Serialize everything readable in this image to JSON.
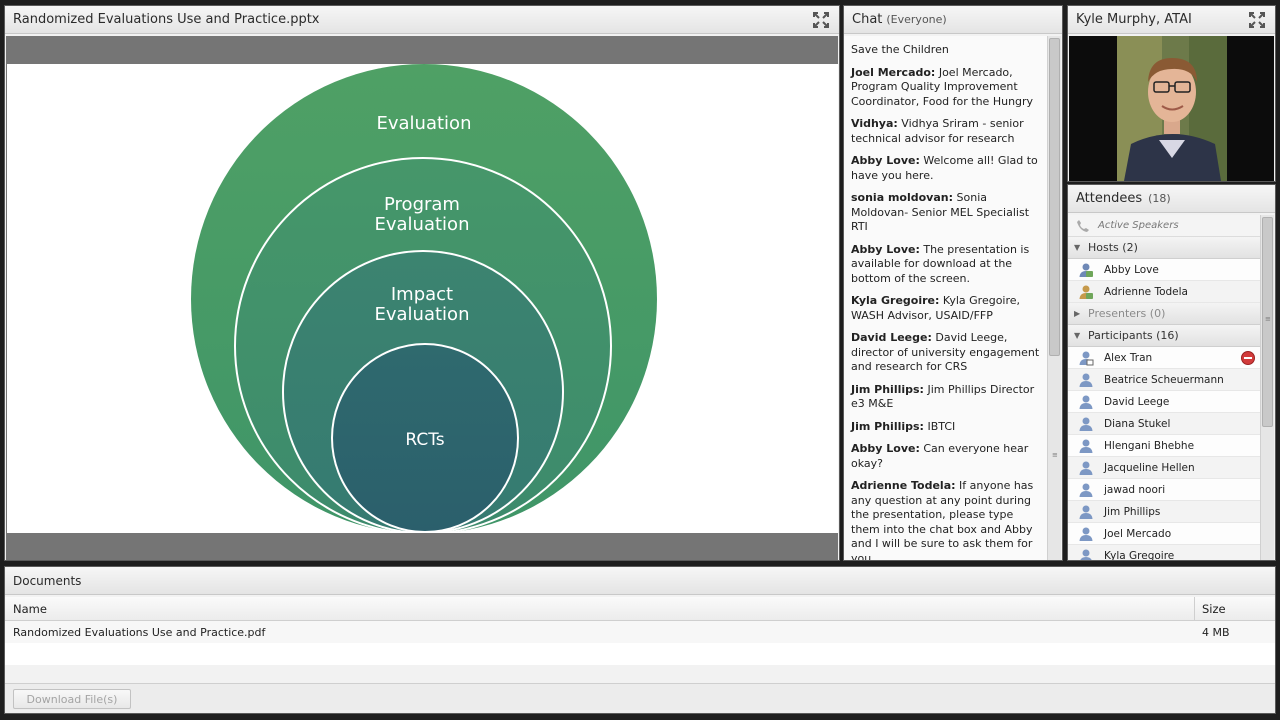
{
  "share": {
    "title": "Randomized Evaluations Use and Practice.pptx",
    "slide": {
      "labels": {
        "evaluation": "Evaluation",
        "program_1": "Program",
        "program_2": "Evaluation",
        "impact_1": "Impact",
        "impact_2": "Evaluation",
        "rcts": "RCTs"
      }
    }
  },
  "chat": {
    "title": "Chat",
    "audience": "(Everyone)",
    "messages": [
      {
        "sender": "",
        "text": "Save the Children"
      },
      {
        "sender": "Joel Mercado:",
        "text": " Joel Mercado, Program Quality Improvement Coordinator, Food for the Hungry"
      },
      {
        "sender": "Vidhya:",
        "text": " Vidhya Sriram - senior technical advisor for research"
      },
      {
        "sender": "Abby Love:",
        "text": " Welcome all! Glad to have you here."
      },
      {
        "sender": "sonia moldovan:",
        "text": " Sonia Moldovan- Senior MEL Specialist RTI"
      },
      {
        "sender": "Abby Love:",
        "text": " The presentation is available for download at the bottom of the screen."
      },
      {
        "sender": "Kyla Gregoire:",
        "text": " Kyla Gregoire, WASH Advisor, USAID/FFP"
      },
      {
        "sender": "David Leege:",
        "text": " David Leege, director of university engagement and research for CRS"
      },
      {
        "sender": "Jim Phillips:",
        "text": " Jim Phillips Director e3 M&E"
      },
      {
        "sender": "Jim Phillips:",
        "text": " IBTCI"
      },
      {
        "sender": "Abby Love:",
        "text": " Can everyone hear okay?"
      },
      {
        "sender": "Adrienne Todela:",
        "text": " If anyone has any question at any point during the presentation, please type them into the chat box and Abby and I will be sure to ask them for you."
      }
    ]
  },
  "video": {
    "title": "Kyle Murphy, ATAI"
  },
  "attendees": {
    "title": "Attendees",
    "count": "(18)",
    "active_speakers": "Active Speakers",
    "hosts_label": "Hosts (2)",
    "hosts": [
      "Abby Love",
      "Adrienne Todela"
    ],
    "presenters_label": "Presenters (0)",
    "participants_label": "Participants (16)",
    "participants": [
      "Alex Tran",
      "Beatrice Scheuermann",
      "David Leege",
      "Diana Stukel",
      "Hlengani Bhebhe",
      "Jacqueline Hellen",
      "jawad noori",
      "Jim Phillips",
      "Joel Mercado",
      "Kyla Gregoire"
    ]
  },
  "documents": {
    "title": "Documents",
    "col_name": "Name",
    "col_size": "Size",
    "files": [
      {
        "name": "Randomized Evaluations Use and Practice.pdf",
        "size": "4 MB"
      }
    ],
    "download_label": "Download File(s)"
  }
}
